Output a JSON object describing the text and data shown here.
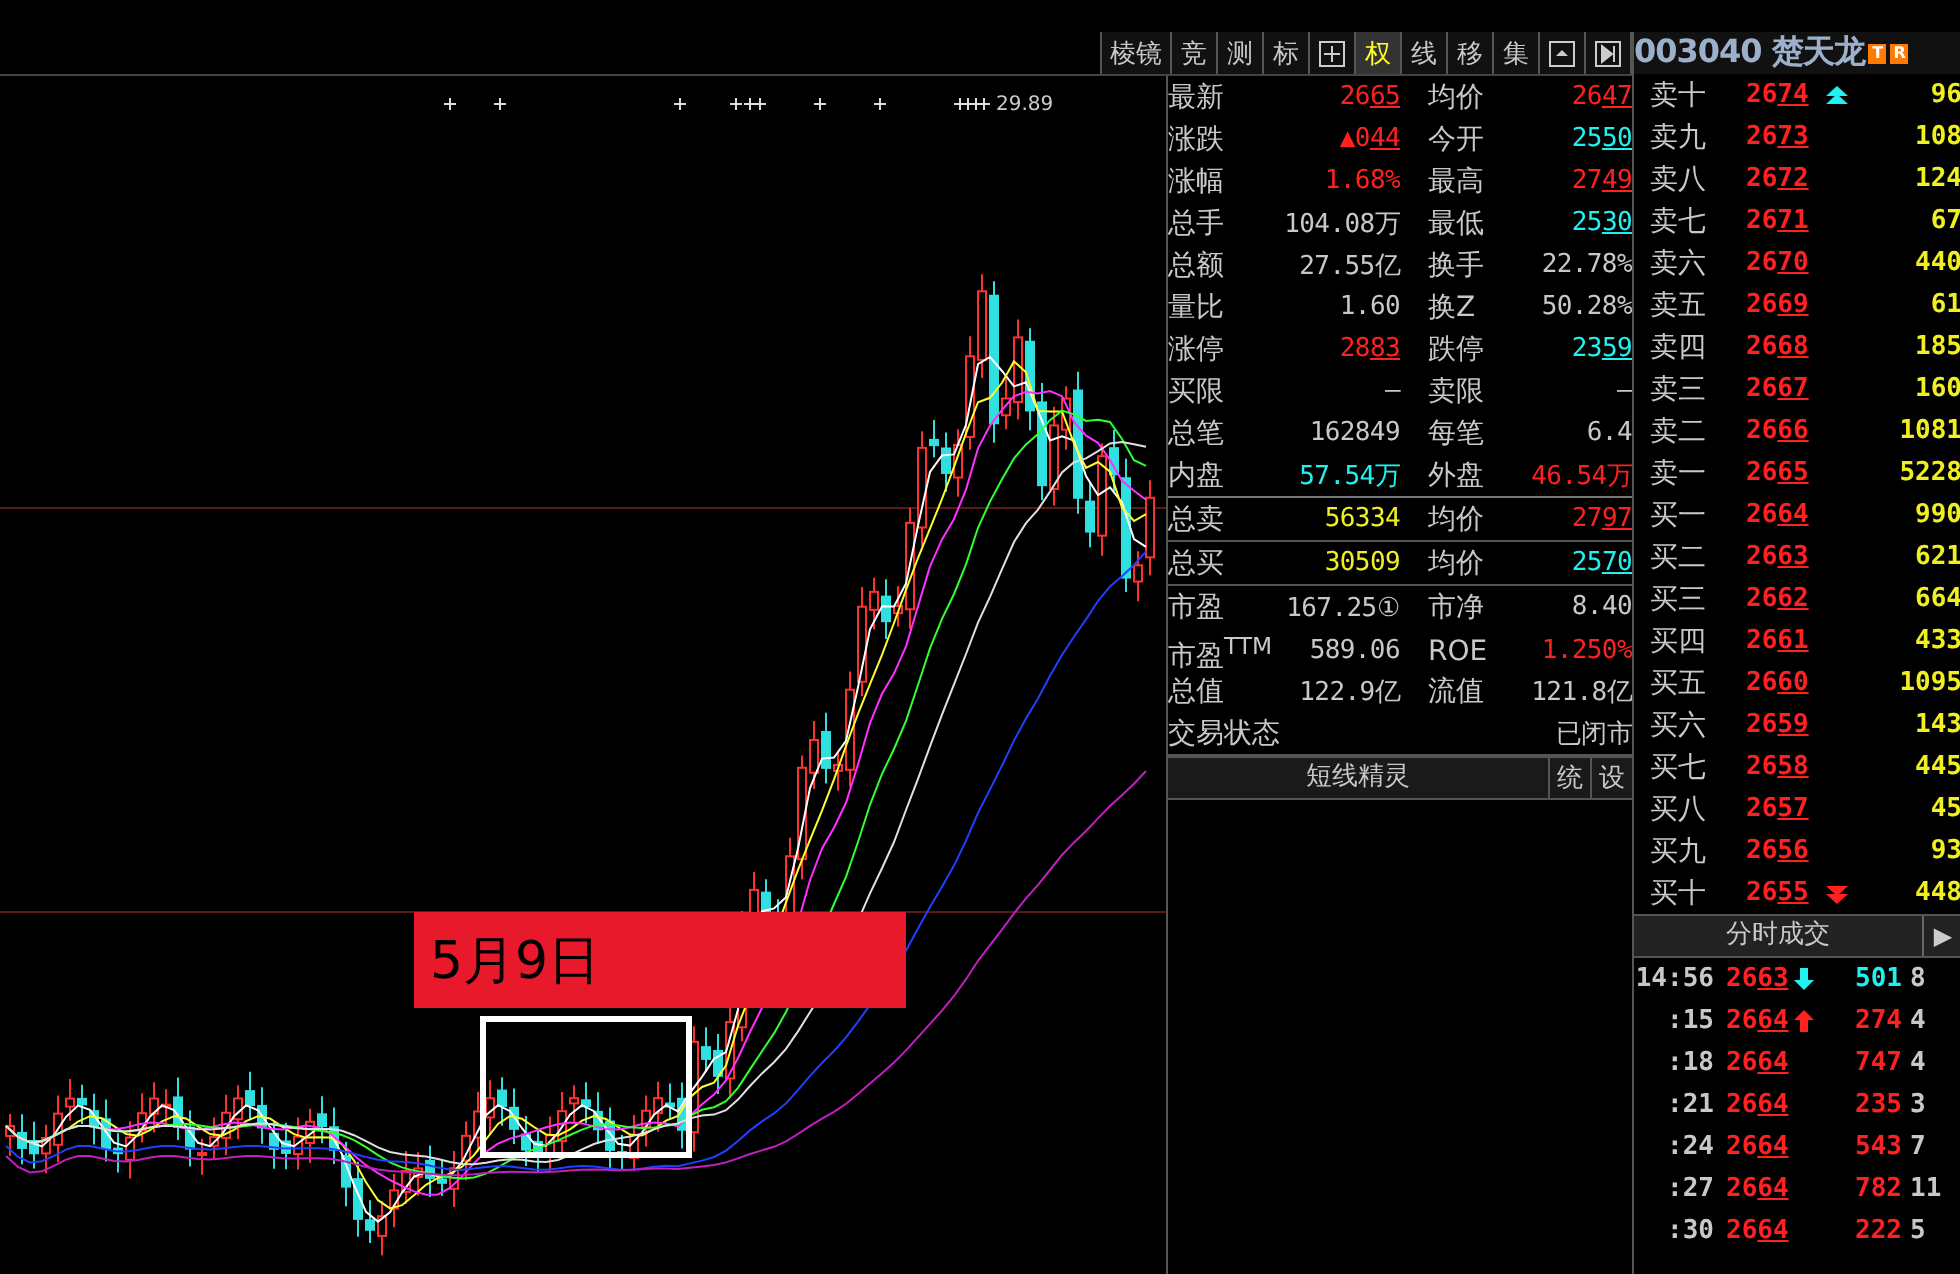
{
  "toolbar": {
    "buttons": [
      {
        "kind": "text",
        "label": "棱镜",
        "selected": false
      },
      {
        "kind": "text",
        "label": "竞",
        "selected": false
      },
      {
        "kind": "text",
        "label": "测",
        "selected": false
      },
      {
        "kind": "text",
        "label": "标",
        "selected": false
      },
      {
        "kind": "grid",
        "selected": false
      },
      {
        "kind": "text",
        "label": "权",
        "selected": true
      },
      {
        "kind": "text",
        "label": "线",
        "selected": false
      },
      {
        "kind": "text",
        "label": "移",
        "selected": false
      },
      {
        "kind": "text",
        "label": "集",
        "selected": false
      },
      {
        "kind": "panel",
        "selected": false
      },
      {
        "kind": "play",
        "selected": false
      }
    ]
  },
  "stock": {
    "title": "003040 楚天龙",
    "badges": [
      "T",
      "R"
    ]
  },
  "chart": {
    "peak_label": "29.89",
    "annotation": "5月9日"
  },
  "stats": {
    "groups": [
      [
        {
          "cells": [
            {
              "label": "最新",
              "value": "2665",
              "color": "#ff2020",
              "underline": true
            },
            {
              "label": "均价",
              "value": "2647",
              "color": "#ff2020",
              "underline": true
            }
          ]
        },
        {
          "cells": [
            {
              "label": "涨跌",
              "value": "▲044",
              "color": "#ff2020",
              "underline": true
            },
            {
              "label": "今开",
              "value": "2550",
              "color": "#20f0f0",
              "underline": true
            }
          ]
        },
        {
          "cells": [
            {
              "label": "涨幅",
              "value": "1.68%",
              "color": "#ff2020",
              "underline": false
            },
            {
              "label": "最高",
              "value": "2749",
              "color": "#ff2020",
              "underline": true
            }
          ]
        },
        {
          "cells": [
            {
              "label": "总手",
              "value": "104.08万",
              "color": "#c8c8c8",
              "underline": false
            },
            {
              "label": "最低",
              "value": "2530",
              "color": "#20f0f0",
              "underline": true
            }
          ]
        },
        {
          "cells": [
            {
              "label": "总额",
              "value": "27.55亿",
              "color": "#c8c8c8",
              "underline": false
            },
            {
              "label": "换手",
              "value": "22.78%",
              "color": "#c8c8c8",
              "underline": false
            }
          ]
        },
        {
          "cells": [
            {
              "label": "量比",
              "value": "1.60",
              "color": "#c8c8c8",
              "underline": false
            },
            {
              "label": "换Z",
              "value": "50.28%",
              "color": "#c8c8c8",
              "underline": false
            }
          ]
        },
        {
          "cells": [
            {
              "label": "涨停",
              "value": "2883",
              "color": "#ff2020",
              "underline": true
            },
            {
              "label": "跌停",
              "value": "2359",
              "color": "#20f0f0",
              "underline": true
            }
          ]
        },
        {
          "cells": [
            {
              "label": "买限",
              "value": "–",
              "color": "#c8c8c8",
              "underline": false
            },
            {
              "label": "卖限",
              "value": "–",
              "color": "#c8c8c8",
              "underline": false
            }
          ]
        },
        {
          "cells": [
            {
              "label": "总笔",
              "value": "162849",
              "color": "#c8c8c8",
              "underline": false
            },
            {
              "label": "每笔",
              "value": "6.4",
              "color": "#c8c8c8",
              "underline": false
            }
          ]
        },
        {
          "cells": [
            {
              "label": "内盘",
              "value": "57.54万",
              "color": "#20f0f0",
              "underline": false
            },
            {
              "label": "外盘",
              "value": "46.54万",
              "color": "#ff2020",
              "underline": false
            }
          ]
        }
      ],
      [
        {
          "cells": [
            {
              "label": "总卖",
              "value": "56334",
              "color": "#f0f020",
              "underline": false
            },
            {
              "label": "均价",
              "value": "2797",
              "color": "#ff2020",
              "underline": true
            }
          ]
        }
      ],
      [
        {
          "cells": [
            {
              "label": "总买",
              "value": "30509",
              "color": "#f0f020",
              "underline": false
            },
            {
              "label": "均价",
              "value": "2570",
              "color": "#20f0f0",
              "underline": true
            }
          ]
        }
      ],
      [
        {
          "cells": [
            {
              "label": "市盈",
              "value": "167.25①",
              "color": "#c8c8c8",
              "underline": false
            },
            {
              "label": "市净",
              "value": "8.40",
              "color": "#c8c8c8",
              "underline": false
            }
          ]
        },
        {
          "cells": [
            {
              "label": "市盈$^{TTM}$",
              "value": "589.06",
              "color": "#c8c8c8",
              "underline": false
            },
            {
              "label": "ROE",
              "value": "1.250%",
              "color": "#ff2020",
              "underline": false
            }
          ]
        },
        {
          "cells": [
            {
              "label": "总值",
              "value": "122.9亿",
              "color": "#c8c8c8",
              "underline": false
            },
            {
              "label": "流值",
              "value": "121.8亿",
              "color": "#c8c8c8",
              "underline": false
            }
          ]
        },
        {
          "cells": [
            {
              "label": "交易状态"
            },
            {
              "value": "已闭市",
              "color": "#c8c8c8",
              "underline": false
            }
          ]
        }
      ]
    ],
    "footer": {
      "title": "短线精灵",
      "buttons": [
        "统",
        "设"
      ]
    }
  },
  "order_book": {
    "rows": [
      {
        "kind": "rising",
        "label": "卖十",
        "price": "2674",
        "qty": "96"
      },
      {
        "kind": "plain",
        "label": "卖九",
        "price": "2673",
        "qty": "108"
      },
      {
        "kind": "plain",
        "label": "卖八",
        "price": "2672",
        "qty": "124"
      },
      {
        "kind": "plain",
        "label": "卖七",
        "price": "2671",
        "qty": "67"
      },
      {
        "kind": "plain",
        "label": "卖六",
        "price": "2670",
        "qty": "440"
      },
      {
        "kind": "plain",
        "label": "卖五",
        "price": "2669",
        "qty": "61"
      },
      {
        "kind": "plain",
        "label": "卖四",
        "price": "2668",
        "qty": "185"
      },
      {
        "kind": "plain",
        "label": "卖三",
        "price": "2667",
        "qty": "160"
      },
      {
        "kind": "plain",
        "label": "卖二",
        "price": "2666",
        "qty": "1081"
      },
      {
        "kind": "plain",
        "label": "卖一",
        "price": "2665",
        "qty": "5228"
      },
      {
        "kind": "plain",
        "label": "买一",
        "price": "2664",
        "qty": "990"
      },
      {
        "kind": "plain",
        "label": "买二",
        "price": "2663",
        "qty": "621"
      },
      {
        "kind": "plain",
        "label": "买三",
        "price": "2662",
        "qty": "664"
      },
      {
        "kind": "plain",
        "label": "买四",
        "price": "2661",
        "qty": "433"
      },
      {
        "kind": "plain",
        "label": "买五",
        "price": "2660",
        "qty": "1095"
      },
      {
        "kind": "plain",
        "label": "买六",
        "price": "2659",
        "qty": "143"
      },
      {
        "kind": "plain",
        "label": "买七",
        "price": "2658",
        "qty": "445"
      },
      {
        "kind": "plain",
        "label": "买八",
        "price": "2657",
        "qty": "45"
      },
      {
        "kind": "plain",
        "label": "买九",
        "price": "2656",
        "qty": "93"
      },
      {
        "kind": "falling",
        "label": "买十",
        "price": "2655",
        "qty": "448"
      }
    ]
  },
  "trades": {
    "title": "分时成交",
    "button": "▶",
    "rows": [
      {
        "kind": "falling",
        "time": "14:56",
        "price": "2663",
        "volume": "501",
        "color": "#20f0f0",
        "column_5": "8"
      },
      {
        "kind": "rising",
        "time": ":15",
        "price": "2664",
        "volume": "274",
        "color": "#ff2020",
        "column_5": "4"
      },
      {
        "kind": "plain",
        "time": ":18",
        "price": "2664",
        "volume": "747",
        "color": "#ff2020",
        "column_5": "4"
      },
      {
        "kind": "plain",
        "time": ":21",
        "price": "2664",
        "volume": "235",
        "color": "#ff2020",
        "column_5": "3"
      },
      {
        "kind": "plain",
        "time": ":24",
        "price": "2664",
        "volume": "543",
        "color": "#ff2020",
        "column_5": "7"
      },
      {
        "kind": "plain",
        "time": ":27",
        "price": "2664",
        "volume": "782",
        "color": "#ff2020",
        "column_5": "11"
      },
      {
        "kind": "plain",
        "time": ":30",
        "price": "2664",
        "volume": "222",
        "color": "#ff2020",
        "column_5": "5"
      }
    ]
  }
}
